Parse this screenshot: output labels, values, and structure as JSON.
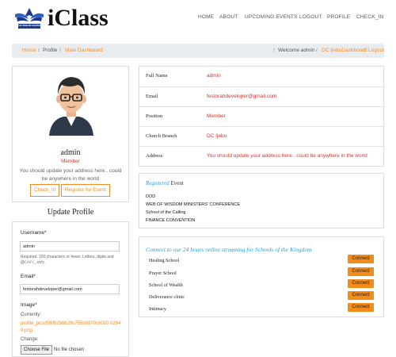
{
  "brand": {
    "name": "iClass",
    "emblem_text": "THE DREAM CENTRE"
  },
  "nav": {
    "items": [
      "HOME",
      "ABOUT",
      "UPCOMING EVENTS",
      "LOGOUT",
      "PROFILE",
      "CHECK_IN"
    ]
  },
  "breadcrumb": {
    "home": "Home",
    "profile": "Profile",
    "current": "Main Dashboard",
    "welcome": "Welcome admin",
    "link1": "DC IjebuDashboard",
    "link2": "Logout",
    "sep": "/"
  },
  "profile_card": {
    "username": "admin",
    "role": "Member",
    "address_note": "You should update your address here.. could be anywhere in the world",
    "checkin_label": "Check_in",
    "register_label": "Register for Event"
  },
  "update_profile": {
    "title": "Update Profile",
    "username_label": "Username*",
    "username_value": "admin",
    "username_help": "Required. 150 characters or fewer. Letters, digits and @/./+/-/_ only.",
    "email_label": "Email*",
    "email_value": "festorahdeveloper@gmail.com",
    "image_label": "Image*",
    "currently_label": "Currently:",
    "current_file": "profile_pics/5f6fb256629c755b8870c6010 02940.png",
    "change_label": "Change:",
    "choose_file": "Choose File",
    "no_file": "No file chosen"
  },
  "details": [
    {
      "key": "Full Name",
      "value": "admin"
    },
    {
      "key": "Email",
      "value": "festorahdeveloper@gmail.com"
    },
    {
      "key": "Position",
      "value": "Member"
    },
    {
      "key": "Church Branch",
      "value": "DC Ijebu"
    },
    {
      "key": "Address",
      "value": "You should update your address here.. could be anywhere in the world"
    }
  ],
  "events": {
    "heading_em": "Registered",
    "heading_rest": "Event",
    "items": [
      "DOD",
      "WEB OF WISDOM MINISTERS' CONFERENCE",
      "School of the Calling",
      "FINANCE CONVENTION"
    ]
  },
  "streaming": {
    "heading": "Connect to our 24 hours online streaming for Schools of the Kingdom",
    "connect_label": "Connect",
    "schools": [
      "Healing School",
      "Prayer School",
      "School of Wealth",
      "Deliverance clinic",
      "Intimacy"
    ]
  },
  "colors": {
    "accent": "#f28c28",
    "danger": "#d9342b",
    "heading_blue": "#2a9fd6"
  }
}
